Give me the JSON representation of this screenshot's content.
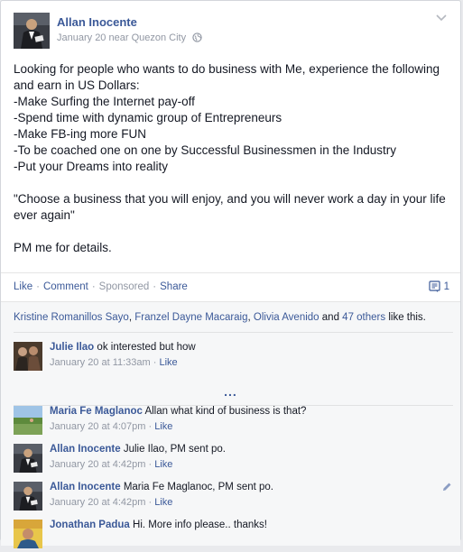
{
  "post": {
    "author": "Allan Inocente",
    "date": "January 20",
    "location_text": "near Quezon City",
    "body_paragraphs": [
      "Looking for people who wants to do business with Me, experience the following and earn in US Dollars:\n-Make Surfing the Internet pay-off\n-Spend time with dynamic group of Entrepreneurs\n-Make FB-ing more FUN\n-To be coached one on one by Successful Businessmen in the Industry\n-Put your Dreams into reality",
      "\"Choose a business that you will enjoy, and you will never work a day in your life ever again\"",
      "PM me for details."
    ]
  },
  "actions": {
    "like": "Like",
    "comment": "Comment",
    "sponsored": "Sponsored",
    "share": "Share",
    "comment_count": "1"
  },
  "likes": {
    "name1": "Kristine Romanillos Sayo",
    "name2": "Franzel Dayne Macaraig",
    "name3": "Olivia Avenido",
    "and": "and",
    "others": "47 others",
    "suffix": "like this."
  },
  "more_comments": "...",
  "comments": [
    {
      "name": "Julie Ilao",
      "text": "ok interested but how",
      "time": "January 20 at 11:33am",
      "like": "Like"
    },
    {
      "name": "Maria Fe Maglanoc",
      "text": "Allan what kind of business is that?",
      "time": "January 20 at 4:07pm",
      "like": "Like"
    },
    {
      "name": "Allan Inocente",
      "text": "Julie Ilao, PM sent po.",
      "time": "January 20 at 4:42pm",
      "like": "Like"
    },
    {
      "name": "Allan Inocente",
      "text": "Maria Fe Maglanoc, PM sent po.",
      "time": "January 20 at 4:42pm",
      "like": "Like"
    },
    {
      "name": "Jonathan Padua",
      "text": "Hi. More info please.. thanks!",
      "time": "",
      "like": ""
    }
  ],
  "colors": {
    "link": "#3b5998",
    "muted": "#9197a3",
    "ufi_bg": "#f6f7f8"
  },
  "icons": [
    "globe-icon",
    "chevron-down-icon",
    "comment-icon",
    "pencil-icon"
  ]
}
